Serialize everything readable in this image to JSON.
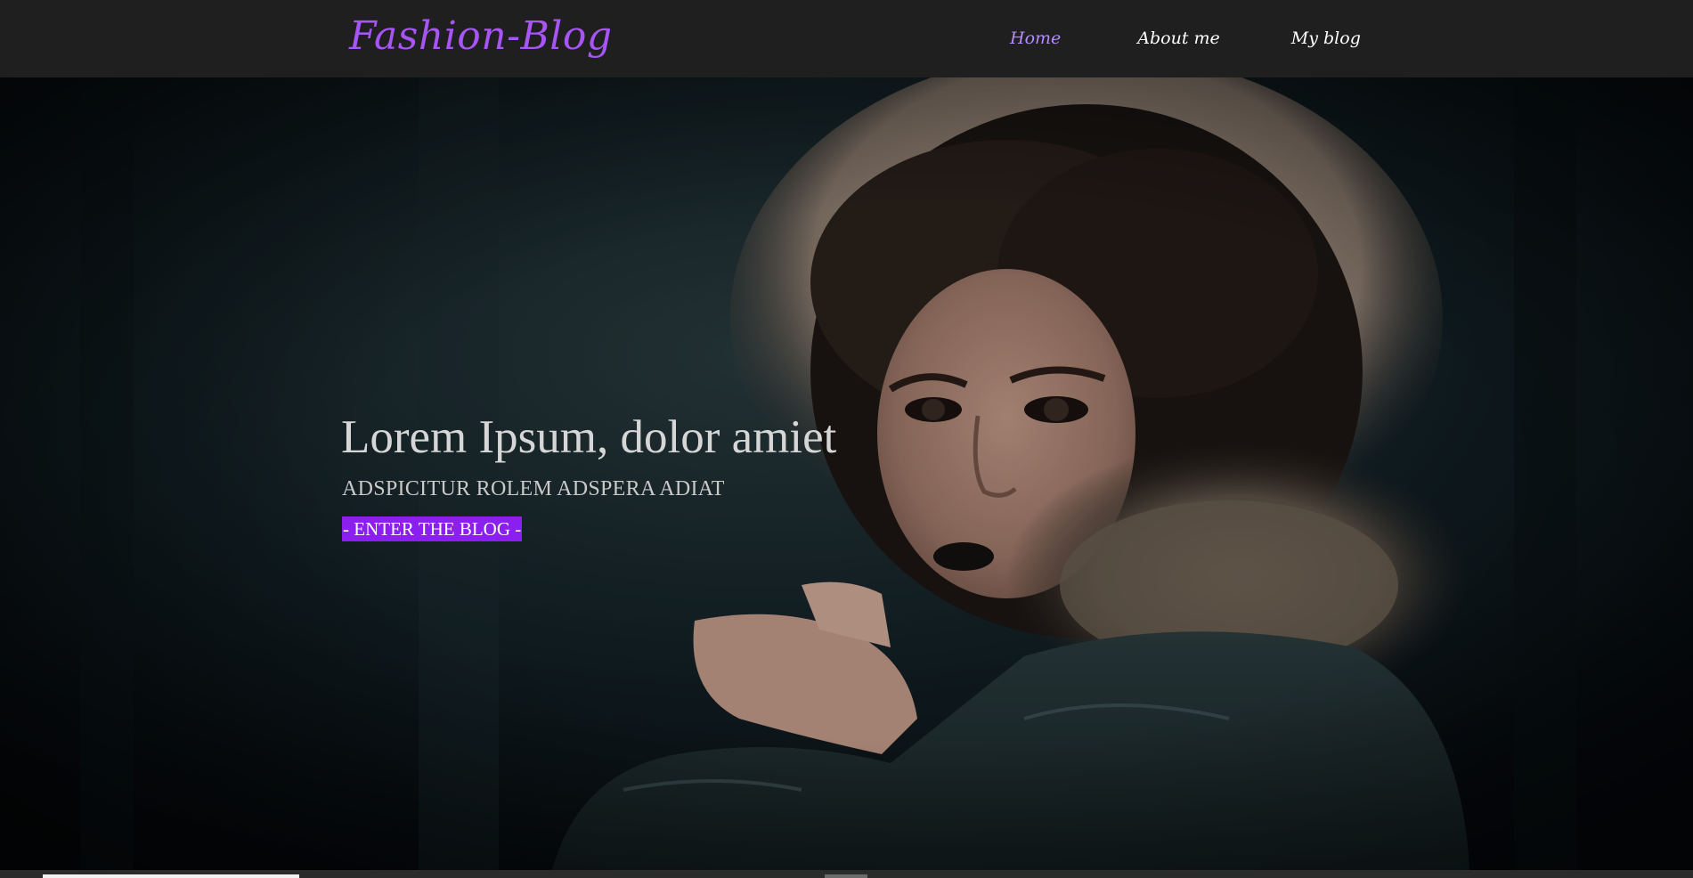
{
  "navbar": {
    "brand": "Fashion-Blog",
    "links": [
      {
        "label": "Home",
        "active": true
      },
      {
        "label": "About me",
        "active": false
      },
      {
        "label": "My blog",
        "active": false
      }
    ]
  },
  "hero": {
    "title": "Lorem Ipsum, dolor amiet",
    "subtitle": "ADSPICITUR ROLEM ADSPERA ADIAT",
    "cta_label": "- ENTER THE BLOG -"
  },
  "colors": {
    "accent": "#a855f7",
    "active_link": "#b48cff",
    "cta_background": "#8b1ff0",
    "navbar_background": "#1f1f1f"
  },
  "icons": {
    "hero_image": "woman-in-fur-hood-photo"
  }
}
